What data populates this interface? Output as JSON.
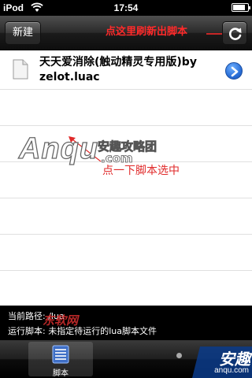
{
  "status_bar": {
    "carrier": "iPod",
    "time": "17:54",
    "battery_level": 0.85
  },
  "nav": {
    "new_label": "新建",
    "refresh_note": "点这里刷新出脚本",
    "refresh_icon": "refresh-icon"
  },
  "list": {
    "items": [
      {
        "name": "天天爱消除(触动精灵专用版)by zelot.luac",
        "icon": "file-icon",
        "accessory": "disclosure-icon"
      }
    ],
    "tap_note": "点一下脚本选中"
  },
  "watermark": {
    "text": "Anqu",
    "cn": "安趣攻略团",
    "com": ".com",
    "bottom": "东软网"
  },
  "info": {
    "path_label": "当前路径:",
    "path_value": "/lua",
    "running_label": "运行脚本:",
    "running_value": "未指定待运行的lua脚本文件"
  },
  "tabs": [
    {
      "label": "脚本",
      "icon": "script-list-icon",
      "selected": true
    }
  ],
  "badge": {
    "cn": "安趣",
    "url": "anqu.com"
  },
  "colors": {
    "annotation_red": "#ff2a2a",
    "disclosure_blue": "#2a6fd8"
  }
}
